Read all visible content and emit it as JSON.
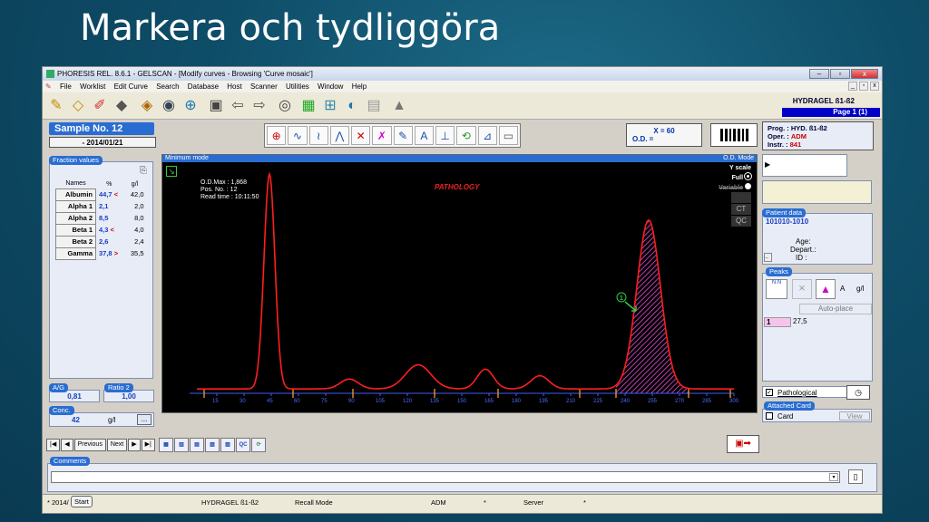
{
  "slide": {
    "title": "Markera och tydliggöra"
  },
  "window": {
    "title": "PHORESIS REL. 8.6.1 - GELSCAN - [Modify curves - Browsing 'Curve mosaic']",
    "min": "–",
    "max": "▫",
    "close": "x"
  },
  "menu": [
    "File",
    "Worklist",
    "Edit Curve",
    "Search",
    "Database",
    "Host",
    "Scanner",
    "Utilities",
    "Window",
    "Help"
  ],
  "mdi": [
    "_",
    "▫",
    "x"
  ],
  "header": {
    "hydragel": "HYDRAGEL ß1-ß2",
    "page": "Page 1 (1)"
  },
  "sample": {
    "label": "Sample No.  12",
    "date": "- 2014/01/21"
  },
  "readout": {
    "x": "X = 60",
    "od": "O.D. ="
  },
  "prog": {
    "prog_label": "Prog. :",
    "prog_value": "HYD. ß1-ß2",
    "oper_label": "Oper. :",
    "oper_value": "ADM",
    "instr_label": "Instr. :",
    "instr_value": "841"
  },
  "fraction": {
    "header": "Fraction values",
    "col_names": "Names",
    "col_pct": "%",
    "col_gl": "g/l",
    "rows": [
      {
        "name": "Albumin",
        "pct": "44,7",
        "flag": "<",
        "gl": "42,0"
      },
      {
        "name": "Alpha 1",
        "pct": "2,1",
        "flag": "",
        "gl": "2,0"
      },
      {
        "name": "Alpha 2",
        "pct": "8,5",
        "flag": "",
        "gl": "8,0"
      },
      {
        "name": "Beta 1",
        "pct": "4,3",
        "flag": "<",
        "gl": "4,0"
      },
      {
        "name": "Beta 2",
        "pct": "2,6",
        "flag": "",
        "gl": "2,4"
      },
      {
        "name": "Gamma",
        "pct": "37,8",
        "flag": ">",
        "gl": "35,5"
      }
    ]
  },
  "ag": {
    "label": "A/G",
    "value": "0,81"
  },
  "ratio": {
    "label": "Ratio 2",
    "value": "1,00"
  },
  "conc": {
    "label": "Conc.",
    "value": "42",
    "unit": "g/l",
    "btn": "..."
  },
  "chart": {
    "mode": "Minimum mode",
    "od_mode": "O.D. Mode",
    "yscale": "Y scale",
    "full": "Full",
    "variable": "Variable",
    "odmax": "O.D.Max : 1,868",
    "pos": "Pos. No. : 12",
    "readtime": "Read time : 10:11:50",
    "pathology": "PATHOLOGY",
    "ct": "CT",
    "qc": "QC",
    "peak_marker": "1"
  },
  "chart_data": {
    "type": "line",
    "title": "",
    "xlabel": "",
    "ylabel": "",
    "xlim": [
      0,
      300
    ],
    "x_ticks": [
      15,
      30,
      45,
      60,
      75,
      90,
      105,
      120,
      135,
      150,
      165,
      180,
      195,
      210,
      225,
      240,
      255,
      270,
      285,
      300
    ]
  },
  "patient": {
    "header": "Patient data",
    "id": "101010-1010",
    "age": "Age:",
    "depart": "Depart.:",
    "id_label": "ID :",
    "dots": ".."
  },
  "peaks": {
    "header": "Peaks",
    "nn": "N.N",
    "a": "A",
    "gl": "g/l",
    "autoplace": "Auto-place",
    "row_num": "1",
    "row_value": "27,5"
  },
  "pathological": {
    "label": "Pathological"
  },
  "attached": {
    "header": "Attached Card",
    "card": "Card",
    "view": "View"
  },
  "nav": {
    "previous": "Previous",
    "next": "Next",
    "first": "|◀",
    "prev_arrow": "◀",
    "next_arrow": "▶",
    "last": "▶|"
  },
  "comments": {
    "header": "Comments"
  },
  "status": {
    "date": "* 2014/",
    "start": "Start",
    "hydragel": "HYDRAGEL ß1-ß2",
    "mode": "Recall Mode",
    "user": "ADM",
    "star1": "*",
    "server": "Server",
    "star2": "*"
  }
}
